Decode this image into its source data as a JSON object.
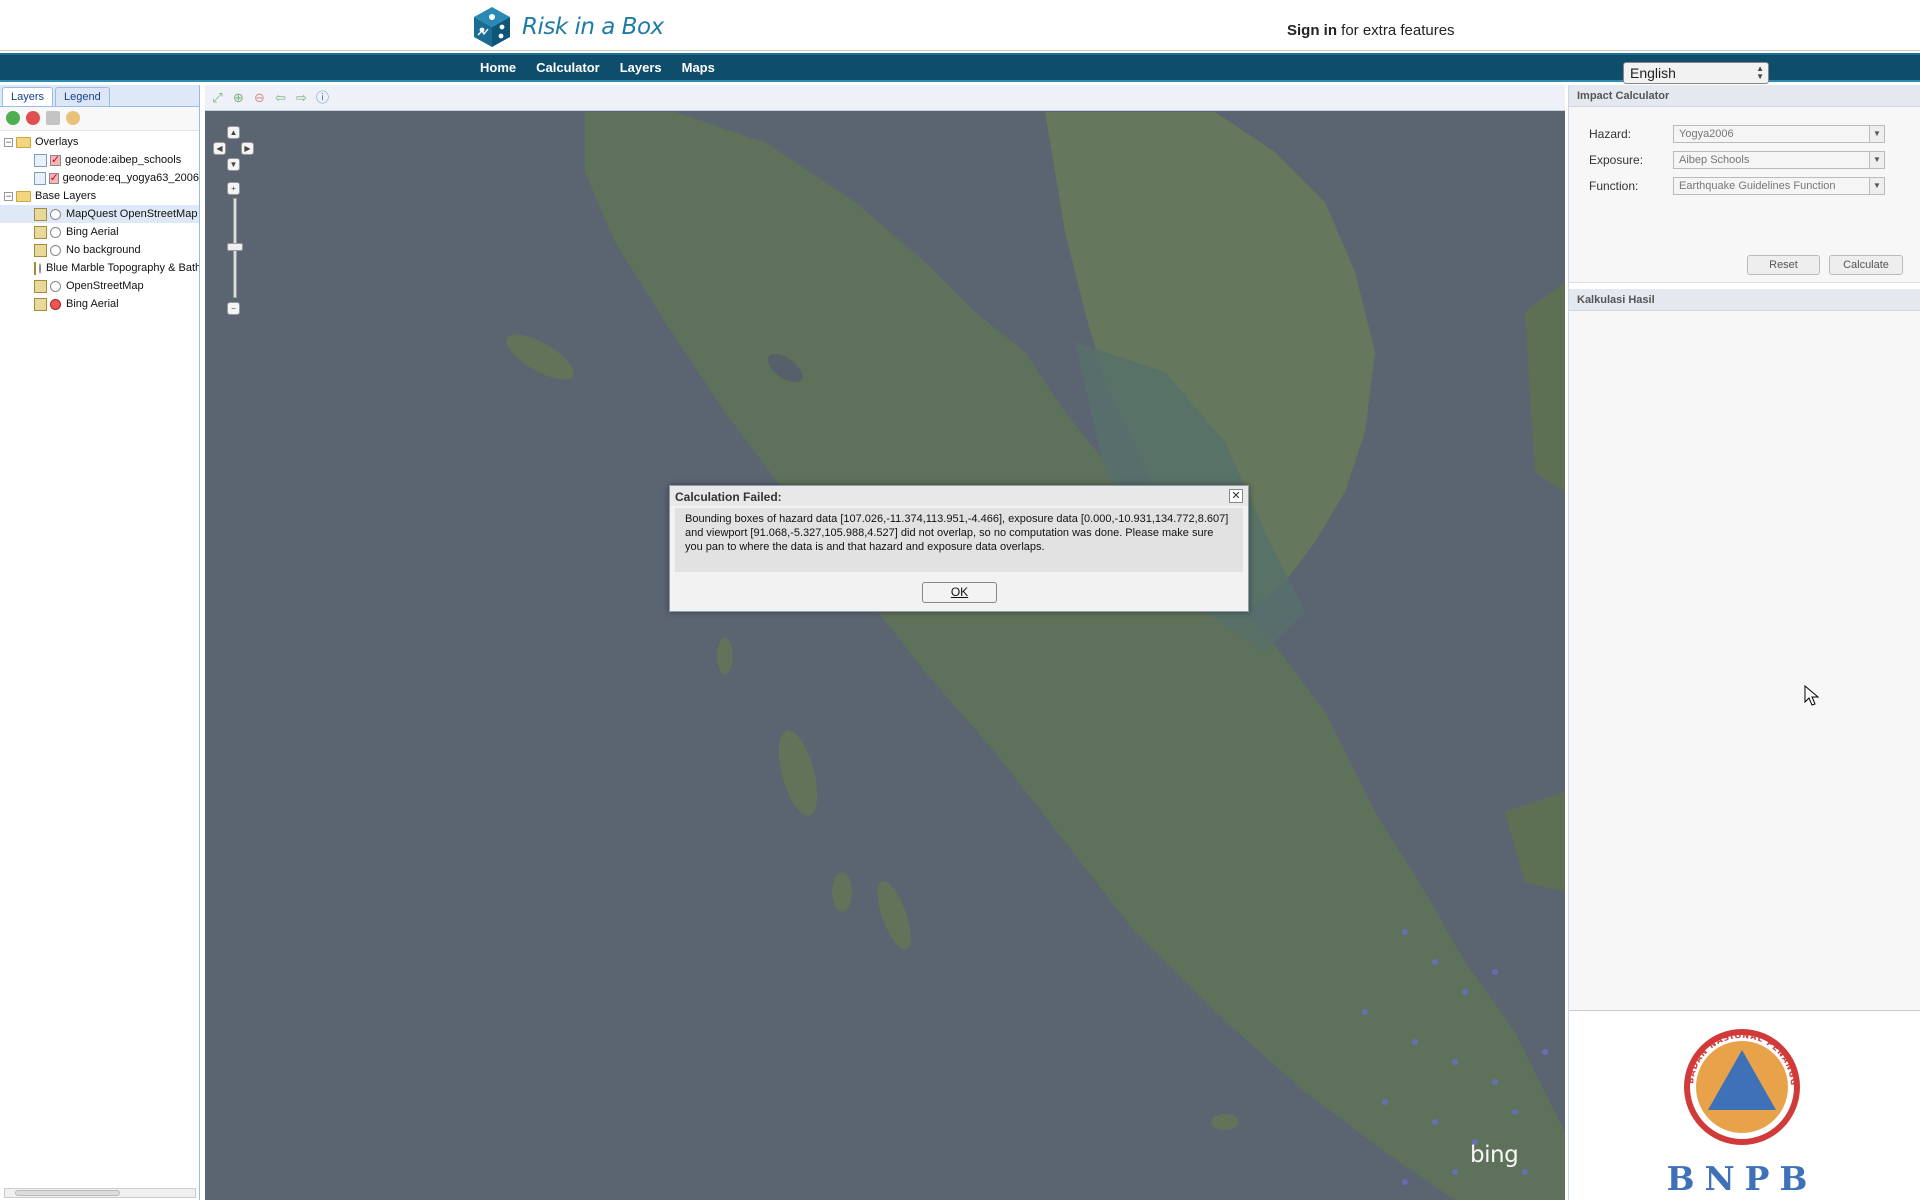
{
  "header": {
    "logo_text": "Risk in a Box",
    "signin_bold": "Sign in",
    "signin_rest": " for extra features"
  },
  "nav": {
    "items": [
      {
        "label": "Home"
      },
      {
        "label": "Calculator"
      },
      {
        "label": "Layers"
      },
      {
        "label": "Maps"
      }
    ],
    "language": "English"
  },
  "left_panel": {
    "tabs": [
      {
        "label": "Layers",
        "active": true
      },
      {
        "label": "Legend",
        "active": false
      }
    ],
    "toolbar_icons": [
      "add-layer-icon",
      "remove-layer-icon",
      "layer-properties-icon",
      "style-icon"
    ],
    "overlays_label": "Overlays",
    "overlays": [
      {
        "label": "geonode:aibep_schools",
        "checked": true
      },
      {
        "label": "geonode:eq_yogya63_2006",
        "checked": true
      }
    ],
    "base_layers_label": "Base Layers",
    "base_layers": [
      {
        "label": "MapQuest OpenStreetMap",
        "selected": false,
        "highlight": true
      },
      {
        "label": "Bing Aerial",
        "selected": false,
        "highlight": false
      },
      {
        "label": "No background",
        "selected": false,
        "highlight": false
      },
      {
        "label": "Blue Marble Topography & Bathymetry",
        "selected": false,
        "highlight": false
      },
      {
        "label": "OpenStreetMap",
        "selected": false,
        "highlight": false
      },
      {
        "label": "Bing Aerial",
        "selected": true,
        "highlight": false
      }
    ]
  },
  "map": {
    "toolbar_icons": [
      "zoom-extent-icon",
      "zoom-in-box-icon",
      "zoom-out-box-icon",
      "previous-view-icon",
      "next-view-icon",
      "info-icon"
    ],
    "attribution": "bing"
  },
  "right_panel": {
    "calc_title": "Impact Calculator",
    "hazard_label": "Hazard:",
    "hazard_value": "Yogya2006",
    "exposure_label": "Exposure:",
    "exposure_value": "Aibep Schools",
    "function_label": "Function:",
    "function_value": "Earthquake Guidelines Function",
    "reset_label": "Reset",
    "calculate_label": "Calculate",
    "result_title": "Kalkulasi Hasil",
    "bnpb_text": "BNPB",
    "bnpb_seal_text": "BADAN NASIONAL PENANGGULANGAN BENCANA"
  },
  "dialog": {
    "title": "Calculation Failed:",
    "message": "Bounding boxes of hazard data [107.026,-11.374,113.951,-4.466], exposure data [0.000,-10.931,134.772,8.607] and viewport [91.068,-5.327,105.988,4.527] did not overlap, so no computation was done. Please make sure you pan to where the data is and that hazard and exposure data overlaps.",
    "ok_label": "OK"
  },
  "colors": {
    "navbar": "#0e4d6b",
    "brand": "#1f7aa7",
    "map_sea": "#5b6471",
    "land": "#5f7258"
  }
}
